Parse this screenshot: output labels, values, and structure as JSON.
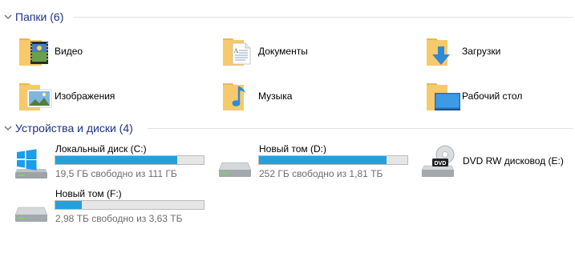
{
  "folders_group": {
    "title": "Папки (6)",
    "items": [
      {
        "label": "Видео",
        "icon": "video-folder-icon"
      },
      {
        "label": "Документы",
        "icon": "documents-folder-icon"
      },
      {
        "label": "Загрузки",
        "icon": "downloads-folder-icon"
      },
      {
        "label": "Изображения",
        "icon": "pictures-folder-icon"
      },
      {
        "label": "Музыка",
        "icon": "music-folder-icon"
      },
      {
        "label": "Рабочий стол",
        "icon": "desktop-folder-icon"
      }
    ]
  },
  "drives_group": {
    "title": "Устройства и диски (4)",
    "items": [
      {
        "label": "Локальный диск (C:)",
        "free": "19,5 ГБ свободно из 111 ГБ",
        "used_fraction": 0.82,
        "icon": "windows-drive-icon"
      },
      {
        "label": "Новый том (D:)",
        "free": "252 ГБ свободно из 1,81 ТБ",
        "used_fraction": 0.86,
        "icon": "hard-drive-icon"
      },
      {
        "label": "DVD RW дисковод (E:)",
        "icon": "dvd-drive-icon"
      },
      {
        "label": "Новый том (F:)",
        "free": "2,98 ТБ свободно из 3,63 ТБ",
        "used_fraction": 0.18,
        "icon": "hard-drive-icon"
      }
    ]
  },
  "colors": {
    "header_text": "#1e3287",
    "usage_bar": "#26a0da",
    "folder_yellow": "#f6c96a"
  }
}
